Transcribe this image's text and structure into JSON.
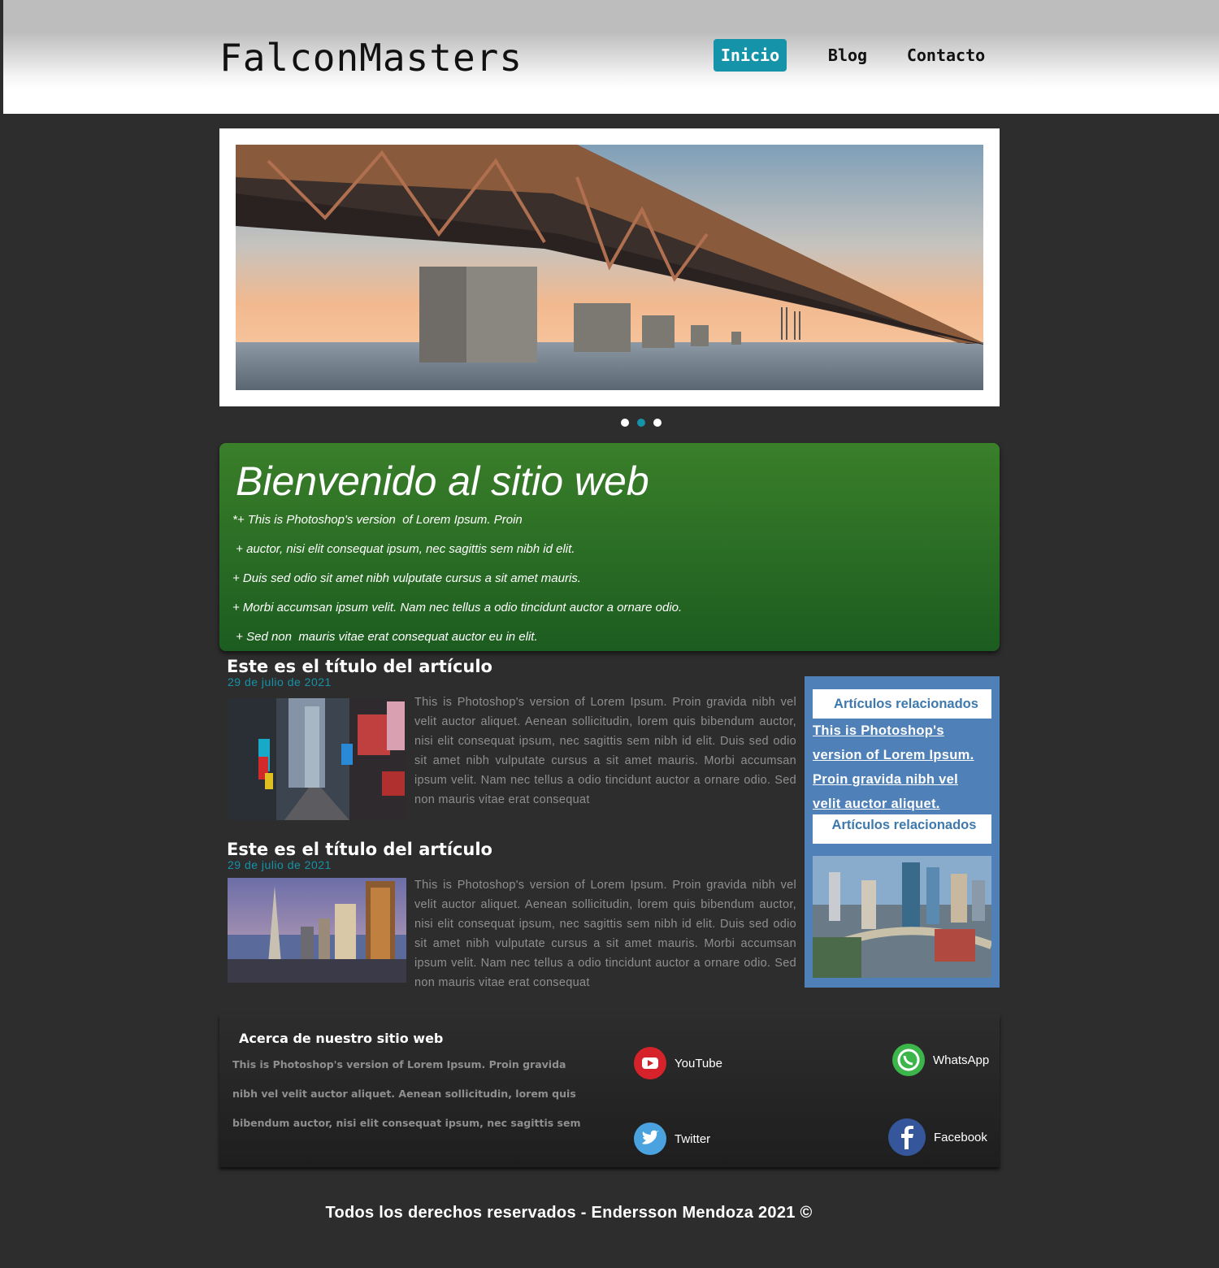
{
  "header": {
    "logo": "FalconMasters",
    "nav": [
      {
        "label": "Inicio",
        "active": true
      },
      {
        "label": "Blog",
        "active": false
      },
      {
        "label": "Contacto",
        "active": false
      }
    ]
  },
  "slider": {
    "dots": 3,
    "active_dot": 1,
    "image": "bridge-photo"
  },
  "welcome": {
    "title": "Bienvenido al sitio web",
    "lines": [
      "*+ This is Photoshop's version  of Lorem Ipsum. Proin",
      " + auctor, nisi elit consequat ipsum, nec sagittis sem nibh id elit.",
      "+ Duis sed odio sit amet nibh vulputate cursus a sit amet mauris.",
      "+ Morbi accumsan ipsum velit. Nam nec tellus a odio tincidunt auctor a ornare odio.",
      " + Sed non  mauris vitae erat consequat auctor eu in elit."
    ]
  },
  "articles": [
    {
      "title": "Este es el título del artículo",
      "date": "29 de julio de 2021",
      "image": "times-square-photo",
      "text": "This is Photoshop's version  of Lorem Ipsum. Proin gravida nibh vel velit auctor aliquet. Aenean sollicitudin, lorem quis bibendum auctor, nisi elit consequat ipsum, nec sagittis sem nibh id elit. Duis sed odio sit amet nibh vulputate cursus a sit amet mauris. Morbi accumsan ipsum velit. Nam nec tellus a odio tincidunt auctor a ornare odio. Sed non  mauris vitae erat consequat"
    },
    {
      "title": "Este es el título del artículo",
      "date": "29 de julio de 2021",
      "image": "city-skyline-photo",
      "text": "This is Photoshop's version  of Lorem Ipsum. Proin gravida nibh vel velit auctor aliquet. Aenean sollicitudin, lorem quis bibendum auctor, nisi elit consequat ipsum, nec sagittis sem nibh id elit. Duis sed odio sit amet nibh vulputate cursus a sit amet mauris. Morbi accumsan ipsum velit. Nam nec tellus a odio tincidunt auctor a ornare odio. Sed non  mauris vitae erat consequat"
    }
  ],
  "sidebar": {
    "heading1": "Artículos relacionados",
    "links": [
      "This is Photoshop's",
      "version  of Lorem Ipsum.",
      "Proin gravida nibh vel",
      "velit auctor aliquet."
    ],
    "heading2": "Artículos relacionados",
    "image": "city-aerial-photo"
  },
  "footer": {
    "about_title": "Acerca de nuestro sitio web",
    "about_lines": [
      "This is Photoshop's version  of Lorem Ipsum. Proin gravida",
      "nibh vel velit auctor aliquet. Aenean sollicitudin, lorem quis",
      "bibendum auctor, nisi elit consequat ipsum, nec sagittis sem"
    ],
    "social": {
      "youtube": "YouTube",
      "whatsapp": "WhatsApp",
      "twitter": "Twitter",
      "facebook": "Facebook"
    },
    "copyright": "Todos los derechos reservados - Endersson Mendoza 2021 ©"
  },
  "colors": {
    "accent": "#1593a8",
    "welcome_green": "#2e6e26",
    "sidebar_blue": "#4f81b8",
    "background": "#2d2d2d"
  }
}
